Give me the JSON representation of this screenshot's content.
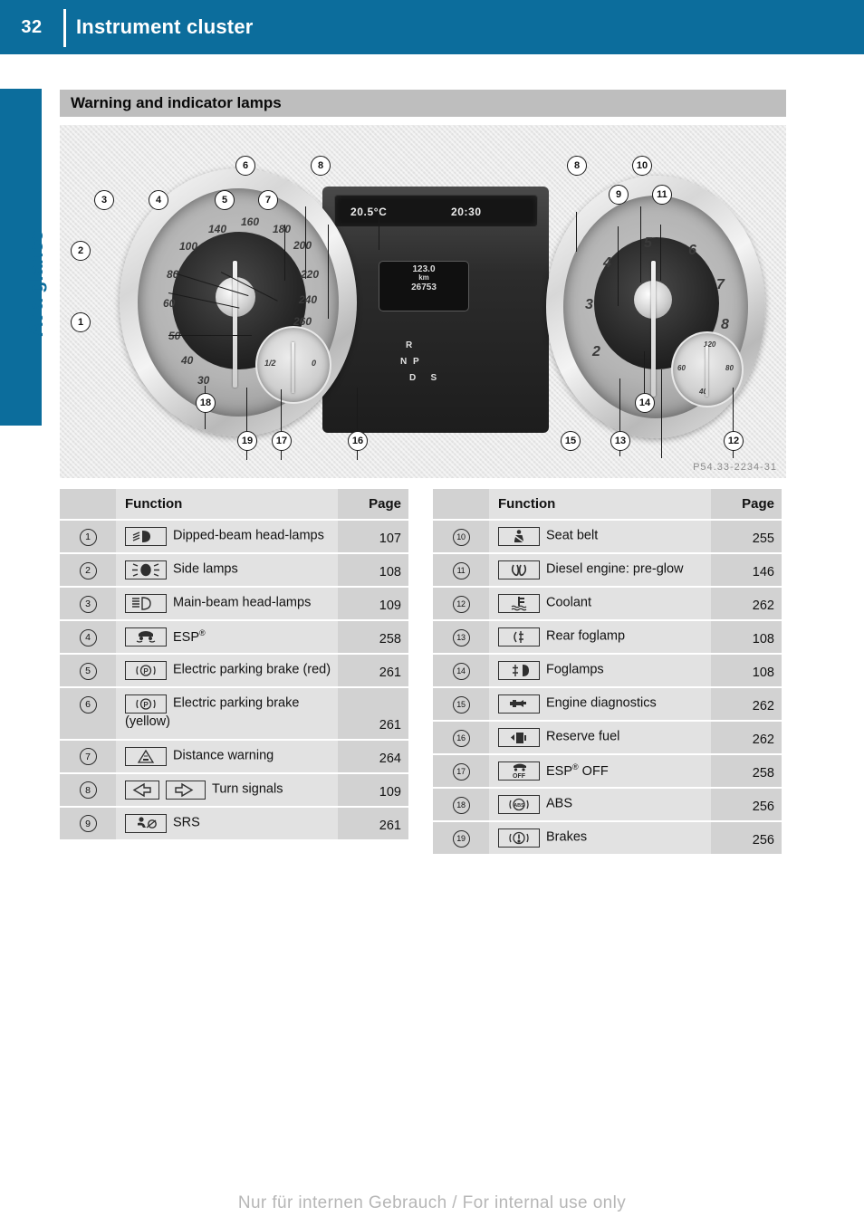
{
  "header": {
    "page_number": "32",
    "title": "Instrument cluster"
  },
  "side_tab": {
    "label": "At a glance"
  },
  "section": {
    "title": "Warning and indicator lamps"
  },
  "illustration": {
    "caption": "P54.33-2234-31",
    "display_temperature": "20.5°C",
    "display_clock": "20:30",
    "odometer_trip": "123.0",
    "odometer_unit": "km",
    "odometer_total": "26753",
    "gear_positions": [
      "R",
      "N",
      "P",
      "D",
      "S"
    ],
    "speedometer_ticks": [
      "30",
      "40",
      "50",
      "60",
      "80",
      "100",
      "140",
      "160",
      "180",
      "200",
      "220",
      "240",
      "260"
    ],
    "tachometer_ticks": [
      "2",
      "3",
      "4",
      "5",
      "6",
      "7",
      "8"
    ],
    "fuel_gauge_labels": [
      "1/2",
      "0"
    ],
    "coolant_gauge_labels": [
      "40",
      "60",
      "80",
      "120"
    ],
    "callouts": [
      "1",
      "2",
      "3",
      "4",
      "5",
      "6",
      "7",
      "8",
      "8",
      "9",
      "10",
      "11",
      "12",
      "13",
      "14",
      "15",
      "16",
      "17",
      "18",
      "19"
    ]
  },
  "tables": {
    "headers": {
      "function": "Function",
      "page": "Page"
    },
    "left_rows": [
      {
        "num": "1",
        "icon": "dipped-beam-headlamp-icon",
        "label": "Dipped-beam head-lamps",
        "page": "107"
      },
      {
        "num": "2",
        "icon": "side-lamp-icon",
        "label": "Side lamps",
        "page": "108"
      },
      {
        "num": "3",
        "icon": "main-beam-headlamp-icon",
        "label": "Main-beam head-lamps",
        "page": "109"
      },
      {
        "num": "4",
        "icon": "esp-icon",
        "label": "ESP®",
        "page": "258",
        "reg": true,
        "base": "ESP"
      },
      {
        "num": "5",
        "icon": "electric-parking-brake-icon",
        "label": "Electric parking brake (red)",
        "page": "261"
      },
      {
        "num": "6",
        "icon": "electric-parking-brake-icon",
        "label": "Electric parking brake (yellow)",
        "page": "261"
      },
      {
        "num": "7",
        "icon": "distance-warning-icon",
        "label": "Distance warning",
        "page": "264"
      },
      {
        "num": "8",
        "icon": "turn-signal-icon",
        "label": "Turn signals",
        "page": "109"
      },
      {
        "num": "9",
        "icon": "srs-airbag-icon",
        "label": "SRS",
        "page": "261"
      }
    ],
    "right_rows": [
      {
        "num": "10",
        "icon": "seat-belt-icon",
        "label": "Seat belt",
        "page": "255"
      },
      {
        "num": "11",
        "icon": "preglow-icon",
        "label": "Diesel engine: pre-glow",
        "page": "146"
      },
      {
        "num": "12",
        "icon": "coolant-icon",
        "label": "Coolant",
        "page": "262"
      },
      {
        "num": "13",
        "icon": "rear-foglamp-icon",
        "label": "Rear foglamp",
        "page": "108"
      },
      {
        "num": "14",
        "icon": "foglamp-icon",
        "label": "Foglamps",
        "page": "108"
      },
      {
        "num": "15",
        "icon": "engine-diagnostics-icon",
        "label": "Engine diagnostics",
        "page": "262"
      },
      {
        "num": "16",
        "icon": "reserve-fuel-icon",
        "label": "Reserve fuel",
        "page": "262"
      },
      {
        "num": "17",
        "icon": "esp-off-icon",
        "label": "ESP® OFF",
        "page": "258",
        "reg": true,
        "base": "ESP",
        "suffix": " OFF"
      },
      {
        "num": "18",
        "icon": "abs-icon",
        "label": "ABS",
        "page": "256"
      },
      {
        "num": "19",
        "icon": "brakes-icon",
        "label": "Brakes",
        "page": "256"
      }
    ]
  },
  "footer": {
    "text": "Nur für internen Gebrauch / For internal use only"
  },
  "colors": {
    "brand_blue": "#0c6d9c",
    "section_bar": "#bebebe",
    "cell_num_bg": "#d2d2d2",
    "cell_fn_bg": "#e2e2e2",
    "illustration_bg": "#e9e9e9",
    "footer_gray": "#b6b6b6"
  }
}
